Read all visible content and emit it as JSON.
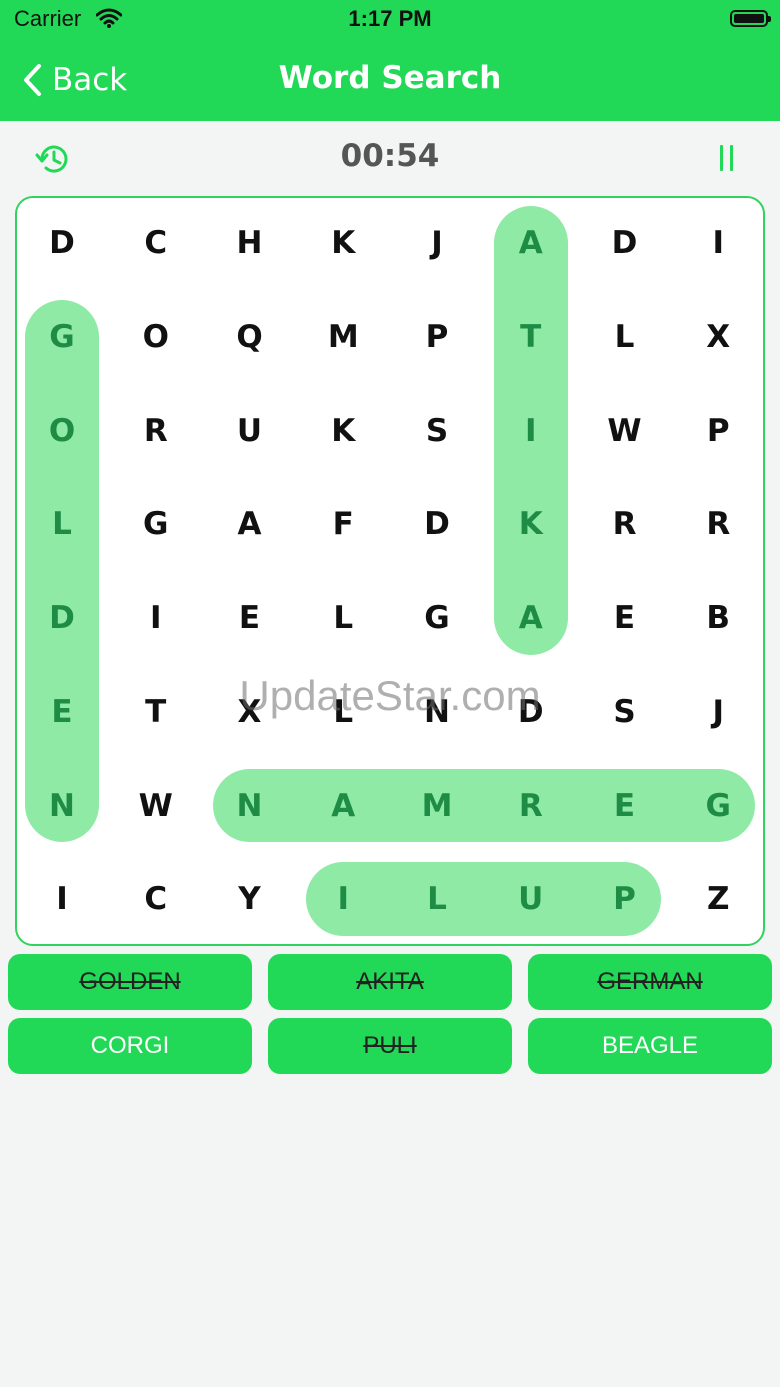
{
  "status_bar": {
    "carrier": "Carrier",
    "time": "1:17 PM"
  },
  "nav": {
    "back_label": "Back",
    "title": "Word Search"
  },
  "toolbar": {
    "timer": "00:54",
    "history_icon": "history-icon",
    "pause_icon": "pause-icon"
  },
  "grid": {
    "rows": [
      [
        "D",
        "C",
        "H",
        "K",
        "J",
        "A",
        "D",
        "I"
      ],
      [
        "G",
        "O",
        "Q",
        "M",
        "P",
        "T",
        "L",
        "X"
      ],
      [
        "O",
        "R",
        "U",
        "K",
        "S",
        "I",
        "W",
        "P"
      ],
      [
        "L",
        "G",
        "A",
        "F",
        "D",
        "K",
        "R",
        "R"
      ],
      [
        "D",
        "I",
        "E",
        "L",
        "G",
        "A",
        "E",
        "B"
      ],
      [
        "E",
        "T",
        "X",
        "L",
        "N",
        "D",
        "S",
        "J"
      ],
      [
        "N",
        "W",
        "N",
        "A",
        "M",
        "R",
        "E",
        "G"
      ],
      [
        "I",
        "C",
        "Y",
        "I",
        "L",
        "U",
        "P",
        "Z"
      ]
    ],
    "found_words": [
      {
        "word": "GOLDEN",
        "start": [
          1,
          0
        ],
        "end": [
          6,
          0
        ]
      },
      {
        "word": "AKITA",
        "start": [
          0,
          5
        ],
        "end": [
          4,
          5
        ]
      },
      {
        "word": "GERMAN",
        "start": [
          6,
          2
        ],
        "end": [
          6,
          7
        ]
      },
      {
        "word": "PULI",
        "start": [
          7,
          3
        ],
        "end": [
          7,
          6
        ]
      }
    ]
  },
  "word_list": [
    {
      "label": "GOLDEN",
      "found": true
    },
    {
      "label": "AKITA",
      "found": true
    },
    {
      "label": "GERMAN",
      "found": true
    },
    {
      "label": "CORGI",
      "found": false
    },
    {
      "label": "PULI",
      "found": true
    },
    {
      "label": "BEAGLE",
      "found": false
    }
  ],
  "watermark": "UpdateStar.com",
  "colors": {
    "accent": "#21d956",
    "highlight": "#8feaa6",
    "found_letter": "#1e8c45"
  }
}
